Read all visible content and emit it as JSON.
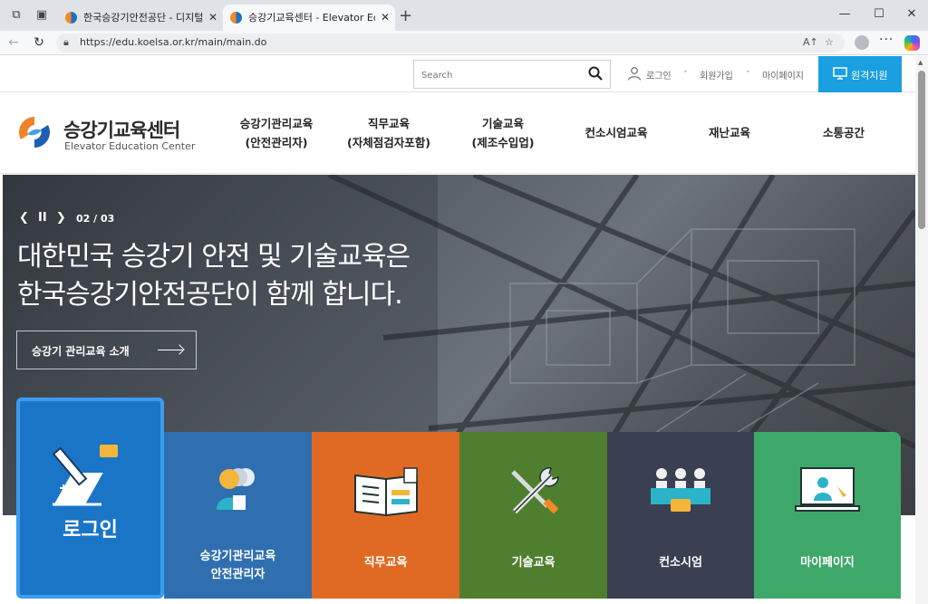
{
  "browser": {
    "tabs": [
      {
        "title": "한국승강기안전공단 - 디지털원",
        "active": false
      },
      {
        "title": "승강기교육센터 - Elevator Educat",
        "active": true
      }
    ],
    "url": "https://edu.koelsa.or.kr/main/main.do",
    "read_aloud_label": "A↑"
  },
  "utility": {
    "search_placeholder": "Search",
    "login": "로그인",
    "signup": "회원가입",
    "mypage": "마이페이지",
    "remote_support": "원격지원"
  },
  "logo": {
    "korean": "승강기교육센터",
    "english": "Elevator Education Center"
  },
  "menu": [
    {
      "line1": "승강기관리교육",
      "line2": "(안전관리자)"
    },
    {
      "line1": "직무교육",
      "line2": "(자체점검자포함)"
    },
    {
      "line1": "기술교육",
      "line2": "(제조수입업)"
    },
    {
      "line1": "컨소시엄교육",
      "line2": ""
    },
    {
      "line1": "재난교육",
      "line2": ""
    },
    {
      "line1": "소통공간",
      "line2": ""
    }
  ],
  "hero": {
    "counter": "02 / 03",
    "title_line1": "대한민국 승강기 안전 및 기술교육은",
    "title_line2": "한국승강기안전공단이 함께 합니다.",
    "button": "승강기 관리교육 소개"
  },
  "quick": {
    "login": "로그인",
    "tiles": [
      {
        "line1": "승강기관리교육",
        "line2": "안전관리자",
        "color": "#2f6fb0"
      },
      {
        "line1": "직무교육",
        "line2": "",
        "color": "#e06a23"
      },
      {
        "line1": "기술교육",
        "line2": "",
        "color": "#4f7f2e"
      },
      {
        "line1": "컨소시엄",
        "line2": "",
        "color": "#3a3f52"
      },
      {
        "line1": "마이페이지",
        "line2": "",
        "color": "#3ea86a"
      }
    ]
  },
  "colors": {
    "accent": "#1a9fe0",
    "login_tile": "#1b75c7"
  }
}
